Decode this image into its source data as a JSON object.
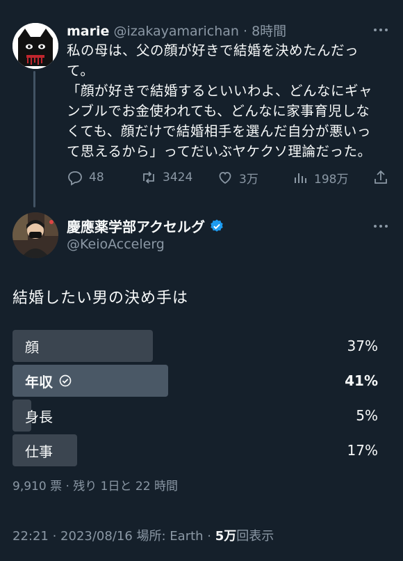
{
  "parent_tweet": {
    "name": "marie",
    "handle": "@izakayamarichan",
    "separator": "·",
    "time": "8時間",
    "text": "私の母は、父の顔が好きで結婚を決めたんだっ\nて。\n「顔が好きで結婚するといいわよ、どんなにギャ\nンブルでお金使われても、どんなに家事育児しな\nくても、顔だけで結婚相手を選んだ自分が悪いっ\nて思えるから」ってだいぶヤケクソ理論だった。",
    "actions": {
      "replies": "48",
      "retweets": "3424",
      "likes": "3万",
      "views": "198万"
    }
  },
  "main_tweet": {
    "name": "慶應薬学部アクセルグ",
    "handle": "@KeioAccelerg",
    "verified": true,
    "text": "結婚したい男の決め手は",
    "poll": {
      "options": [
        {
          "label": "顔",
          "percent_text": "37%",
          "value": 37,
          "winner": false
        },
        {
          "label": "年収",
          "percent_text": "41%",
          "value": 41,
          "winner": true
        },
        {
          "label": "身長",
          "percent_text": "5%",
          "value": 5,
          "winner": false
        },
        {
          "label": "仕事",
          "percent_text": "17%",
          "value": 17,
          "winner": false
        }
      ],
      "meta": "9,910 票 · 残り 1日と 22 時間"
    },
    "timestamp": "22:21 · 2023/08/16 場所: Earth · ",
    "views_count": "5万",
    "views_label": "回表示"
  },
  "colors": {
    "background": "#15202b",
    "verified": "#1d9bf0",
    "muted": "#8b98a5"
  },
  "icons": [
    "reply-icon",
    "retweet-icon",
    "like-icon",
    "views-icon",
    "share-icon",
    "more-icon",
    "verified-badge-icon",
    "check-circle-icon"
  ]
}
